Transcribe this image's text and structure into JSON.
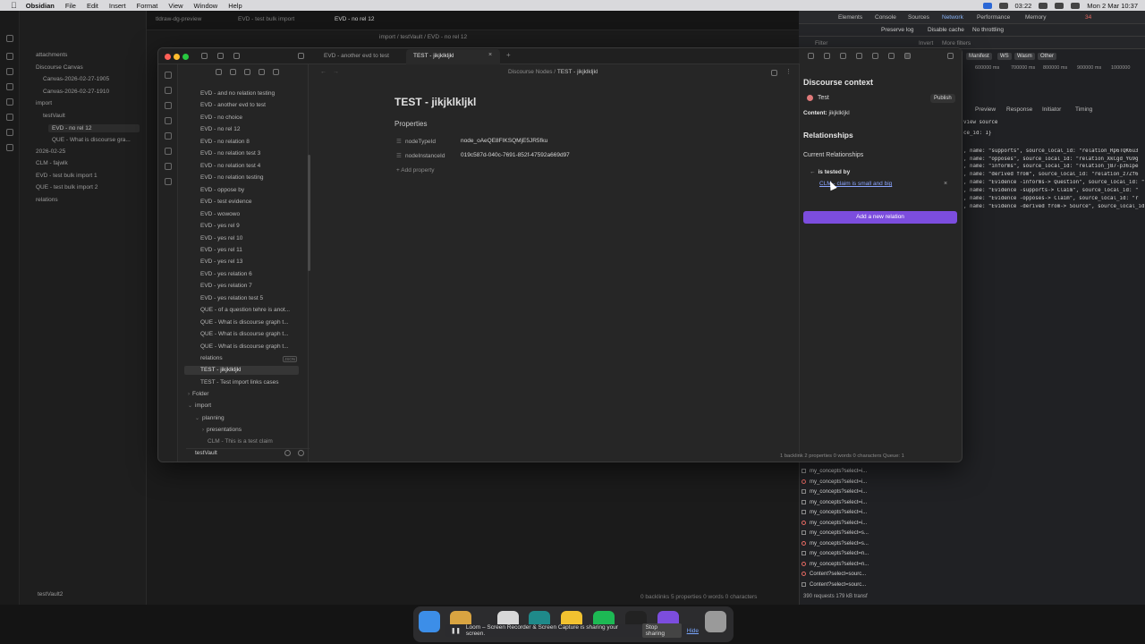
{
  "menubar": {
    "app": "Obsidian",
    "items": [
      "File",
      "Edit",
      "Insert",
      "Format",
      "View",
      "Window",
      "Help"
    ],
    "clock": "Mon 2 Mar 10:37",
    "timer": "03:22"
  },
  "bg_sidebar": {
    "items": [
      {
        "label": "attachments",
        "indent": 0
      },
      {
        "label": "Discourse Canvas",
        "indent": 0
      },
      {
        "label": "Canvas-2026-02-27-1905",
        "indent": 1
      },
      {
        "label": "Canvas-2026-02-27-1910",
        "indent": 1
      },
      {
        "label": "import",
        "indent": 0
      },
      {
        "label": "testVault",
        "indent": 1
      },
      {
        "label": "EVD - no rel 12",
        "indent": 2,
        "selected": true
      },
      {
        "label": "QUE - What is discourse gra...",
        "indent": 2
      },
      {
        "label": "2026-02-25",
        "indent": 0
      },
      {
        "label": "CLM - fajwlk",
        "indent": 0
      },
      {
        "label": "EVD - test bulk import 1",
        "indent": 0
      },
      {
        "label": "QUE - test bulk import 2",
        "indent": 0
      },
      {
        "label": "relations",
        "indent": 0
      }
    ],
    "vault": "testVault2"
  },
  "bg_tabs": [
    "tldraw-dg-preview",
    "EVD - test bulk import",
    "EVD - no rel 12"
  ],
  "bg_breadcrumb": "import / testVault / EVD - no rel 12",
  "bg_status": "0 backlinks   5 properties   0 words  0 characters",
  "devtools": {
    "tabs": [
      "Elements",
      "Console",
      "Sources",
      "Network",
      "Performance",
      "Memory"
    ],
    "active_tab": "Network",
    "issues_count": "34",
    "toolbar": {
      "preserve_log": "Preserve log",
      "disable_cache": "Disable cache",
      "throttling": "No throttling"
    },
    "filter": {
      "placeholder": "Filter",
      "invert": "Invert",
      "more_filters": "More filters"
    },
    "chips": [
      "Manifest",
      "WS",
      "Wasm",
      "Other"
    ],
    "timeline": [
      "600000 ms",
      "700000 ms",
      "800000 ms",
      "900000 ms",
      "1000000"
    ],
    "subtabs": [
      "Preview",
      "Response",
      "Initiator",
      "Timing"
    ],
    "code_lines": [
      "view source",
      "ce_id: 1}",
      ", name: \"supports\", source_local_id: \"relation_Rp6TQK6u3",
      ", name: \"opposes\", source_local_id: \"relation_XkCgd_YG9g",
      ", name: \"informs\", source_local_id: \"relation_jB7-p361pe",
      ", name: \"derived from\", source_local_id: \"relation_z7Zf6",
      ", name: \"Evidence -informs-> Question\", source_local_id: \"",
      ", name: \"Evidence -supports-> Claim\", source_local_id: \"",
      ", name: \"Evidence -opposes-> Claim\", source_local_id: \"r",
      ", name: \"Evidence -derived from-> Source\", source_local_id"
    ],
    "requests": [
      {
        "label": "my_concepts?select=i...",
        "error": false
      },
      {
        "label": "my_concepts?select=i...",
        "error": true
      },
      {
        "label": "my_concepts?select=i...",
        "error": false
      },
      {
        "label": "my_concepts?select=i...",
        "error": false
      },
      {
        "label": "my_concepts?select=i...",
        "error": false
      },
      {
        "label": "my_concepts?select=i...",
        "error": true
      },
      {
        "label": "my_concepts?select=s...",
        "error": false
      },
      {
        "label": "my_concepts?select=s...",
        "error": true
      },
      {
        "label": "my_concepts?select=n...",
        "error": false
      },
      {
        "label": "my_concepts?select=n...",
        "error": true
      },
      {
        "label": "Content?select=sourc...",
        "error": true
      },
      {
        "label": "Content?select=sourc...",
        "error": false
      }
    ],
    "summary": "390 requests   179 kB transf"
  },
  "fg": {
    "tabs": [
      "EVD - another evd to test",
      "TEST - jikjklkljkl"
    ],
    "active_tab": "TEST - jikjklkljkl",
    "explorer": [
      "EVD - and no relation testing",
      "EVD - another evd to test",
      "EVD - no choice",
      "EVD - no rel 12",
      "EVD - no relation 8",
      "EVD - no relation test 3",
      "EVD - no relation test 4",
      "EVD - no relation testing",
      "EVD - oppose by",
      "EVD - test evidence",
      "EVD - wowowo",
      "EVD - yes rel 9",
      "EVD - yes rel 10",
      "EVD - yes rel 11",
      "EVD - yes rel 13",
      "EVD - yes relation 6",
      "EVD - yes relation 7",
      "EVD - yes relation test 5",
      "QUE - of a question tehre is anot...",
      "QUE - What is discourse graph t...",
      "QUE - What is discourse graph t...",
      "QUE - What is discourse graph t...",
      "relations",
      "TEST - jikjklkljkl",
      "TEST - Test import links cases"
    ],
    "explorer_selected": "TEST - jikjklkljkl",
    "md_badge": "JSON",
    "folders": [
      {
        "label": "Folder",
        "indent": 0,
        "chev": "›"
      },
      {
        "label": "import",
        "indent": 0,
        "chev": "⌄"
      },
      {
        "label": "planning",
        "indent": 1,
        "chev": "⌄"
      },
      {
        "label": "presentations",
        "indent": 2,
        "chev": "›"
      },
      {
        "label": "CLM - This is a test claim",
        "indent": 2,
        "chev": ""
      }
    ],
    "vault": "testVault",
    "breadcrumb": {
      "parent": "Discourse Nodes",
      "current": "TEST - jikjklkljkl"
    },
    "note": {
      "title": "TEST - jikjklkljkl",
      "properties_heading": "Properties",
      "properties": [
        {
          "key": "nodeTypeId",
          "value": "node_oAeQE8FIKSQMjE5JR5fku"
        },
        {
          "key": "nodeInstanceId",
          "value": "019c587d-040c-7691-852f-47592a669d97"
        }
      ],
      "add_property": "Add property"
    },
    "discourse": {
      "title": "Discourse context",
      "node_name": "Test",
      "node_color": "#e07a7a",
      "publish": "Publish",
      "content_label": "Content:",
      "content_value": "jikjklkljkl",
      "relationships_heading": "Relationships",
      "current_relationships": "Current Relationships",
      "relation_type": "is tested by",
      "related_node": "CLM - claim is small and big",
      "add_relation": "Add a new relation",
      "accent": "#7c4dde"
    },
    "status": "1 backlink   2 properties     0 words  0 characters          Queue: 1"
  },
  "dock": {
    "loom_text": "Loom – Screen Recorder & Screen Capture is sharing your screen.",
    "stop": "Stop sharing",
    "hide": "Hide"
  }
}
